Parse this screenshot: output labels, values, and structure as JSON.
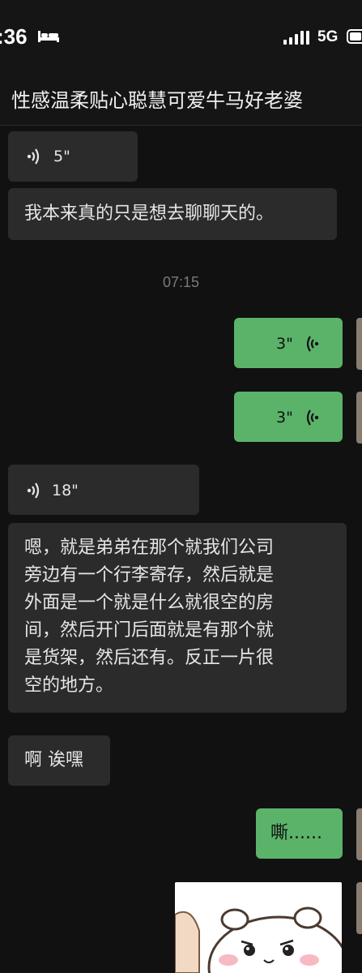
{
  "status_bar": {
    "time": ":36",
    "network": "5G"
  },
  "chat": {
    "title": "性感温柔贴心聪慧可爱牛马好老婆"
  },
  "messages": [
    {
      "type": "voice",
      "side": "in",
      "duration": "5\""
    },
    {
      "type": "text",
      "side": "in",
      "text": "我本来真的只是想去聊聊天的。"
    },
    {
      "type": "timestamp",
      "text": "07:15"
    },
    {
      "type": "voice",
      "side": "out",
      "duration": "3\""
    },
    {
      "type": "voice",
      "side": "out",
      "duration": "3\""
    },
    {
      "type": "voice",
      "side": "in",
      "duration": "18\""
    },
    {
      "type": "text",
      "side": "in",
      "lines": [
        "嗯，就是弟弟在那个就我们公司",
        "旁边有一个行李寄存，然后就是",
        "外面是一个就是什么就很空的房",
        "间，然后开门后面就是有那个就",
        "是货架，然后还有。反正一片很",
        "空的地方。"
      ]
    },
    {
      "type": "text",
      "side": "in",
      "text": "啊 诶嘿"
    },
    {
      "type": "text",
      "side": "out",
      "text": "嘶......"
    },
    {
      "type": "sticker",
      "side": "out",
      "icon": "hamster-sticker-icon"
    }
  ],
  "colors": {
    "background": "#111111",
    "incoming_bubble": "#2b2b2b",
    "outgoing_bubble": "#5bb36a"
  }
}
